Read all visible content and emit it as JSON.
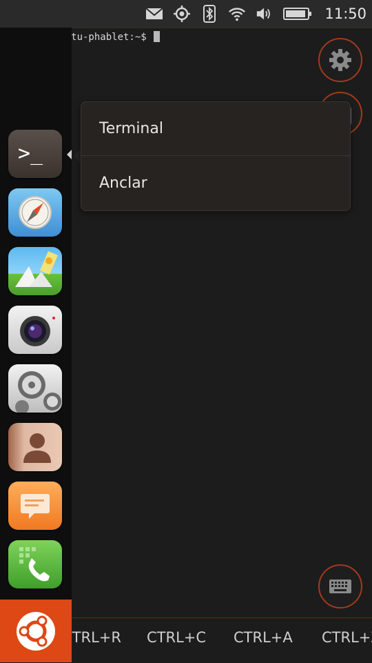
{
  "status_bar": {
    "icons": [
      "mail-icon",
      "location-icon",
      "bluetooth-icon",
      "wifi-icon",
      "volume-icon",
      "battery-icon"
    ],
    "time": "11:50"
  },
  "terminal": {
    "prompt": "phablet@ubuntu-phablet:~$ "
  },
  "context_menu": {
    "items": [
      {
        "label": "Terminal"
      },
      {
        "label": "Anclar"
      }
    ]
  },
  "launcher": {
    "apps": [
      "terminal",
      "browser",
      "gallery",
      "camera",
      "system-settings",
      "contacts",
      "messaging",
      "phone"
    ]
  },
  "key_bar": {
    "keys": [
      "CTRL+R",
      "CTRL+C",
      "CTRL+A",
      "CTRL+Z"
    ]
  },
  "colors": {
    "accent": "#dd4814",
    "menu_bg": "#262321",
    "background": "#1c1c1c"
  }
}
